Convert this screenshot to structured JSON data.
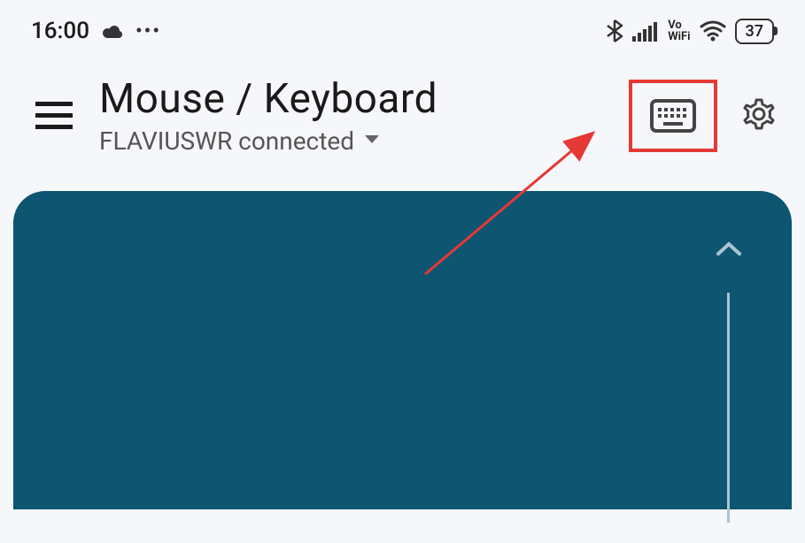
{
  "statusBar": {
    "time": "16:00",
    "battery": "37",
    "voWifiTop": "Vo",
    "voWifiBottom": "WiFi"
  },
  "header": {
    "title": "Mouse / Keyboard",
    "connectionStatus": "FLAVIUSWR connected"
  }
}
